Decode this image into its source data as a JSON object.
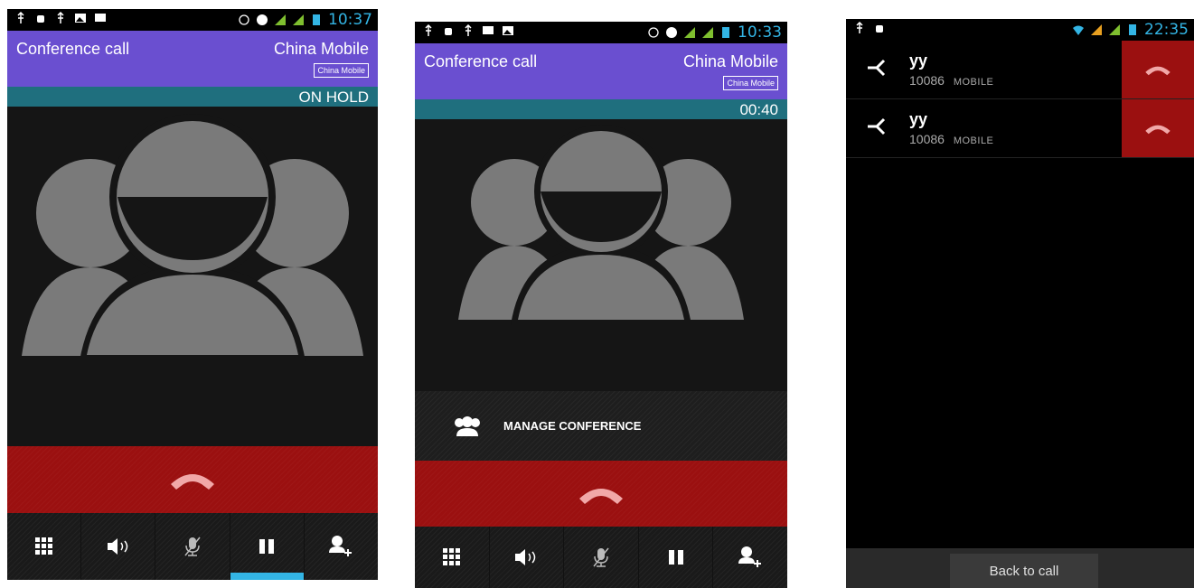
{
  "screen1": {
    "status_time": "10:37",
    "title": "Conference call",
    "carrier": "China Mobile",
    "carrier_badge": "China Mobile",
    "status_text": "ON HOLD",
    "controls": [
      "dialpad-icon",
      "speaker-icon",
      "mute-icon",
      "hold-icon",
      "add-call-icon"
    ],
    "active_control": "hold"
  },
  "screen2": {
    "status_time": "10:33",
    "title": "Conference call",
    "carrier": "China Mobile",
    "carrier_badge": "China Mobile",
    "status_text": "00:40",
    "manage_label": "MANAGE CONFERENCE"
  },
  "screen3": {
    "status_time": "22:35",
    "participants": [
      {
        "name": "yy",
        "number": "10086",
        "type": "MOBILE"
      },
      {
        "name": "yy",
        "number": "10086",
        "type": "MOBILE"
      }
    ],
    "back_label": "Back to call"
  },
  "colors": {
    "title_bar": "#6a4fd0",
    "info_bar": "#1f6f7e",
    "end_call": "#9b1010",
    "accent": "#33b5e5"
  }
}
